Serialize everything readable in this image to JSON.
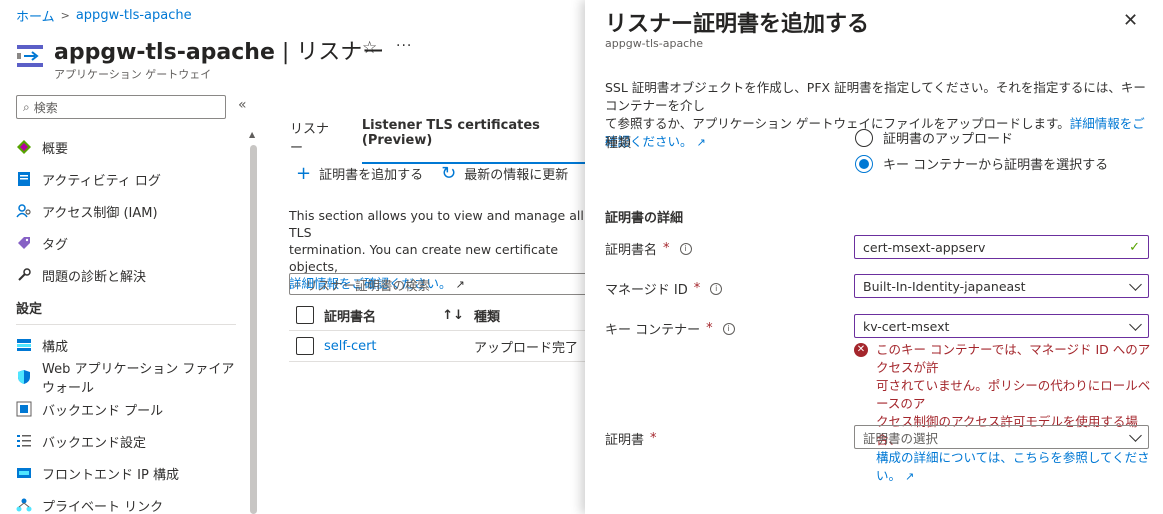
{
  "breadcrumb": {
    "home": "ホーム",
    "resource": "appgw-tls-apache"
  },
  "header": {
    "resource_name": "appgw-tls-apache",
    "blade_suffix": " | リスナー",
    "resource_type": "アプリケーション ゲートウェイ",
    "more": "···"
  },
  "search": {
    "placeholder": "検索"
  },
  "nav": {
    "items": [
      {
        "label": "概要",
        "icon": "overview-icon"
      },
      {
        "label": "アクティビティ ログ",
        "icon": "activity-log-icon"
      },
      {
        "label": "アクセス制御 (IAM)",
        "icon": "iam-icon"
      },
      {
        "label": "タグ",
        "icon": "tag-icon"
      },
      {
        "label": "問題の診断と解決",
        "icon": "wrench-icon"
      }
    ],
    "section_settings": "設定",
    "settings_items": [
      {
        "label": "構成",
        "icon": "config-icon"
      },
      {
        "label": "Web アプリケーション ファイアウォール",
        "icon": "shield-icon"
      },
      {
        "label": "バックエンド プール",
        "icon": "backend-pool-icon"
      },
      {
        "label": "バックエンド設定",
        "icon": "backend-settings-icon"
      },
      {
        "label": "フロントエンド IP 構成",
        "icon": "frontend-ip-icon"
      },
      {
        "label": "プライベート リンク",
        "icon": "private-link-icon"
      }
    ]
  },
  "main": {
    "tabs": [
      "リスナー",
      "Listener TLS certificates (Preview)"
    ],
    "toolbar": {
      "add": "証明書を追加する",
      "refresh": "最新の情報に更新"
    },
    "description": "This section allows you to view and manage all TLS",
    "description2": "termination. You can create new certificate objects, ",
    "learn_more": "詳細情報をご確認ください。",
    "filter_placeholder": "リスナー証明書の検索",
    "columns": {
      "name": "証明書名",
      "type": "種類"
    },
    "rows": [
      {
        "name": "self-cert",
        "type": "アップロード完了"
      }
    ]
  },
  "panel": {
    "title": "リスナー証明書を追加する",
    "subtitle": "appgw-tls-apache",
    "intro_line1": "SSL 証明書オブジェクトを作成し、PFX 証明書を指定してください。それを指定するには、キー コンテナーを介し",
    "intro_line2": "て参照するか、アプリケーション ゲートウェイにファイルをアップロードします。",
    "intro_link": "詳細情報をご確認ください。",
    "type_label": "種類",
    "type_options": [
      "証明書のアップロード",
      "キー コンテナーから証明書を選択する"
    ],
    "type_selected": 1,
    "details_heading": "証明書の詳細",
    "cert_name_label": "証明書名",
    "cert_name_value": "cert-msext-appserv",
    "managed_id_label": "マネージド ID",
    "managed_id_value": "Built-In-Identity-japaneast",
    "key_vault_label": "キー コンテナー",
    "key_vault_value": "kv-cert-msext",
    "error_line1": "このキー コンテナーでは、マネージド ID へのアクセスが許",
    "error_line2": "可されていません。ポリシーの代わりにロールベースのア",
    "error_line3": "クセス制御のアクセス許可モデルを使用する場合、",
    "error_link": "構成の詳細については、こちらを参照してください。",
    "cert_label": "証明書",
    "cert_placeholder": "証明書の選択",
    "required_mark": "*"
  },
  "colors": {
    "accent": "#0078d4",
    "error": "#a4262c",
    "valid": "#57a300",
    "focus_border": "#6b2f9e"
  }
}
